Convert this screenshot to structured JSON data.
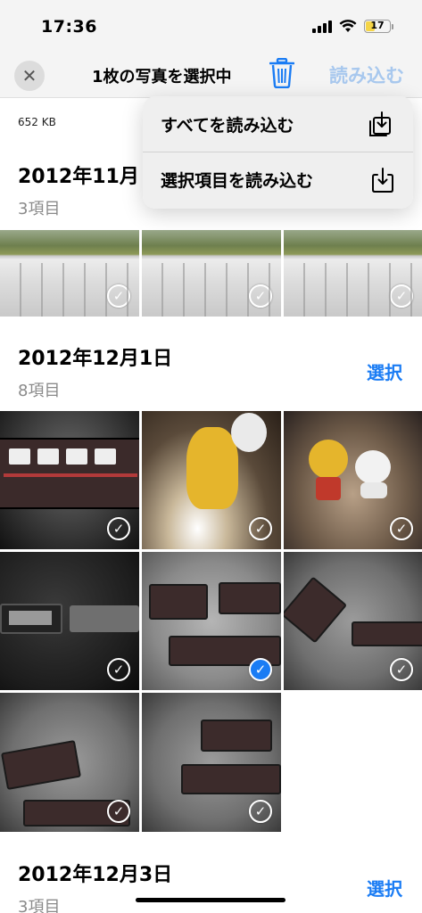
{
  "status_bar": {
    "time": "17:36",
    "battery": "17"
  },
  "nav": {
    "title": "1枚の写真を選択中",
    "import_label": "読み込む"
  },
  "file_size": "652 KB",
  "menu": {
    "items": [
      {
        "label": "すべてを読み込む",
        "icon": "import-all-icon"
      },
      {
        "label": "選択項目を読み込む",
        "icon": "import-selected-icon"
      }
    ]
  },
  "sections": [
    {
      "date": "2012年11月",
      "count": "3項目"
    },
    {
      "date": "2012年12月1日",
      "count": "8項目",
      "select_label": "選択"
    },
    {
      "date": "2012年12月3日",
      "count": "3項目",
      "select_label": "選択"
    }
  ],
  "photos_section1": [
    {
      "kind": "field",
      "selected": false
    },
    {
      "kind": "field",
      "selected": false
    },
    {
      "kind": "field",
      "selected": false
    }
  ],
  "photos_section2": [
    {
      "kind": "train",
      "selected": false
    },
    {
      "kind": "yellow-toy",
      "selected": false
    },
    {
      "kind": "toys",
      "selected": false
    },
    {
      "kind": "train-cars",
      "selected": false
    },
    {
      "kind": "train-cars",
      "selected": true
    },
    {
      "kind": "train-cars",
      "selected": false
    },
    {
      "kind": "train-cars",
      "selected": false
    },
    {
      "kind": "train-cars",
      "selected": false
    }
  ],
  "accent_color": "#1a7cf4",
  "check_glyph": "✓"
}
